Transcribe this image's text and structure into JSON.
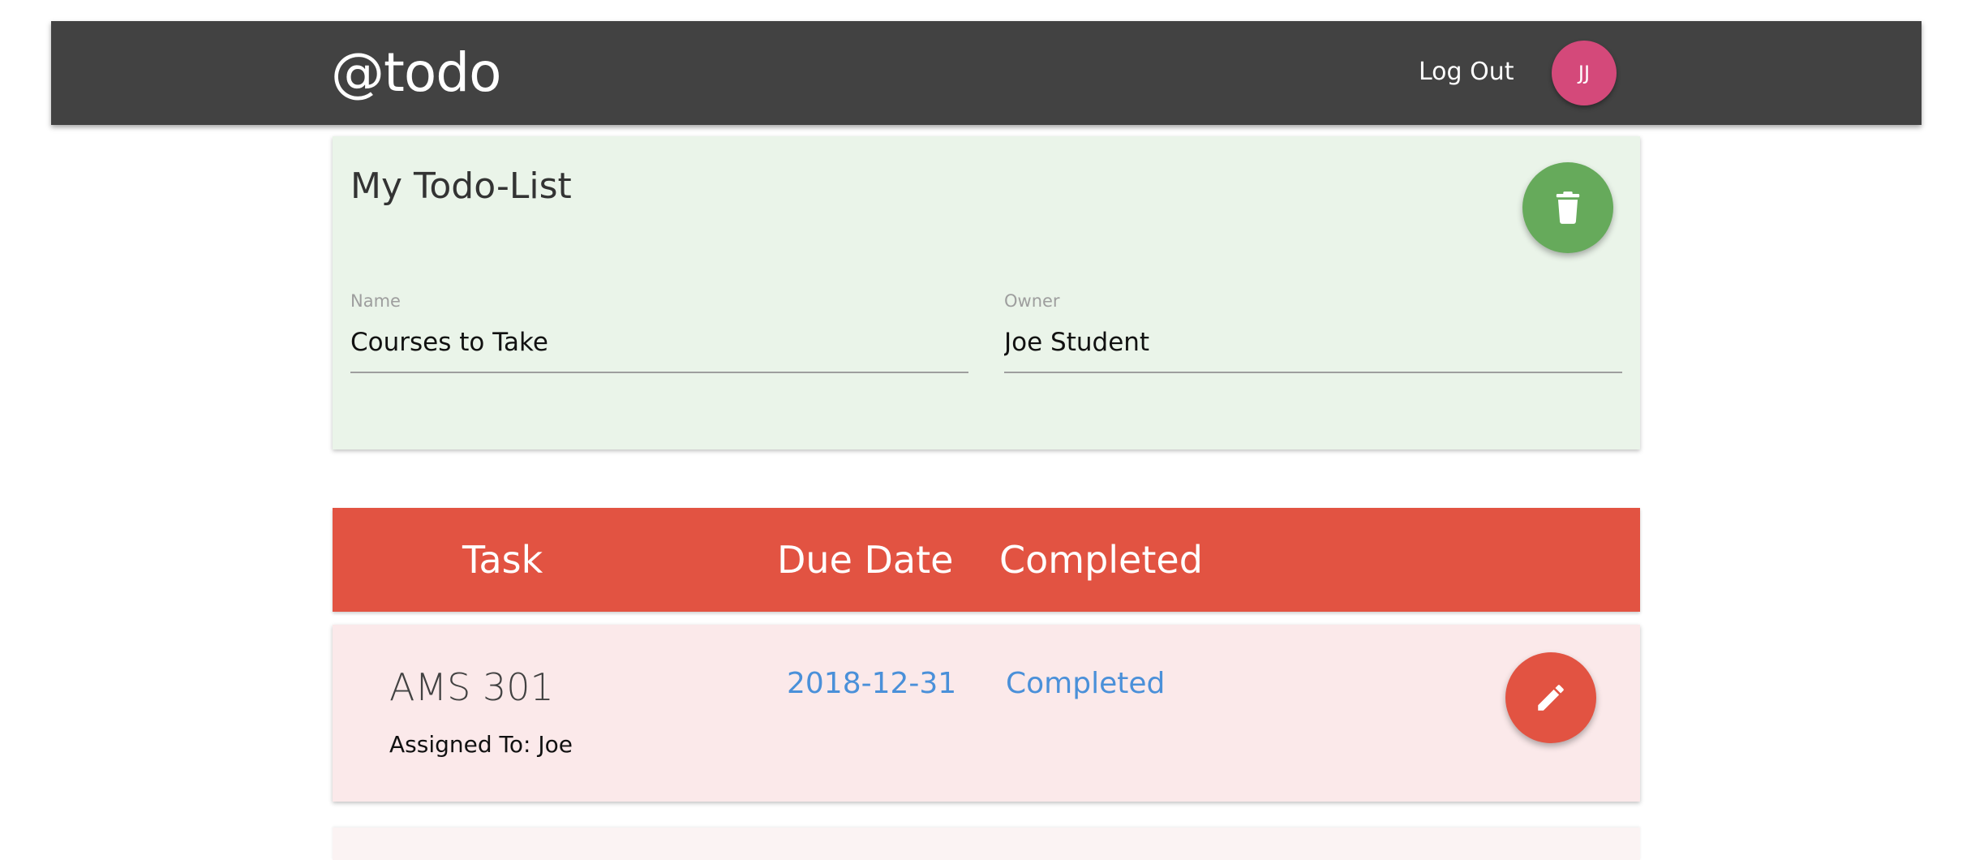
{
  "navbar": {
    "brand": "@todo",
    "logout_label": "Log Out",
    "avatar_initials": "JJ",
    "background_color": "#424242",
    "avatar_color": "#d4497a"
  },
  "list": {
    "title": "My Todo-List",
    "delete_icon": "trash-icon",
    "name_label": "Name",
    "name_value": "Courses to Take",
    "owner_label": "Owner",
    "owner_value": "Joe Student",
    "background_color": "#eaf4e9",
    "delete_button_color": "#66aa5b"
  },
  "items_header": {
    "task": "Task",
    "due_date": "Due Date",
    "completed": "Completed",
    "background_color": "#e25342"
  },
  "items": [
    {
      "name": "AMS 301",
      "assigned": "Assigned To: Joe",
      "due_date": "2018-12-31",
      "status": "Completed",
      "edit_icon": "pencil-icon"
    }
  ]
}
